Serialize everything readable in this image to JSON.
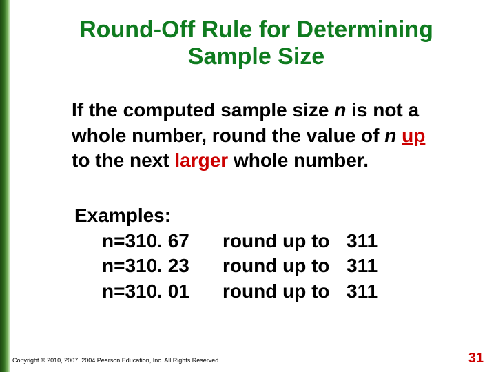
{
  "title": "Round-Off Rule for Determining Sample Size",
  "rule": {
    "t1": "If the computed sample size ",
    "var1": "n",
    "t2": " is not a whole number, round the value of ",
    "var2": "n",
    "t3": " ",
    "up": "up",
    "t4": " to the next ",
    "larger": "larger",
    "t5": " whole number."
  },
  "examples": {
    "heading": "Examples:",
    "rows": [
      {
        "lhs": "n=310. 67",
        "mid": "round up to",
        "rhs": "311"
      },
      {
        "lhs": "n=310. 23",
        "mid": "round up to",
        "rhs": "311"
      },
      {
        "lhs": "n=310. 01",
        "mid": "round up to",
        "rhs": "311"
      }
    ]
  },
  "copyright": "Copyright © 2010, 2007, 2004 Pearson Education, Inc. All Rights Reserved.",
  "page_number": "31"
}
